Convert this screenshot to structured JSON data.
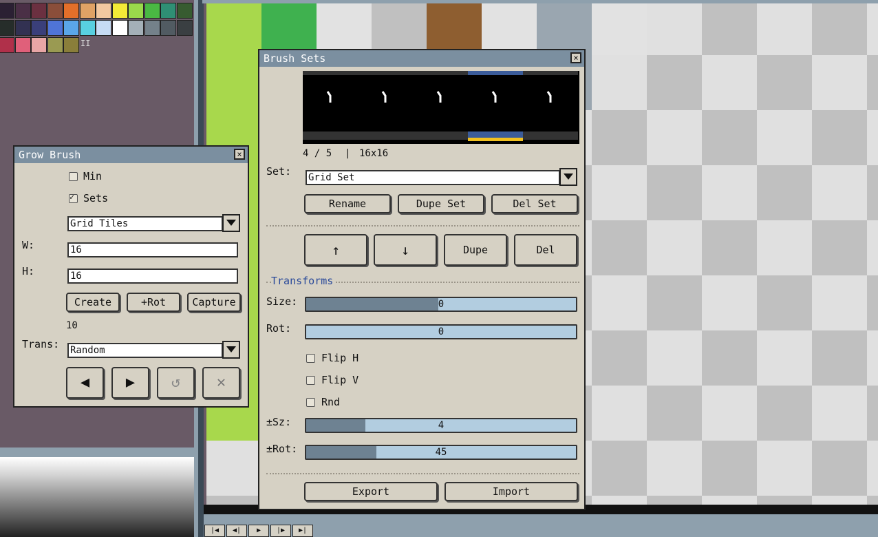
{
  "palette": {
    "colors": [
      "#2b2033",
      "#4a2f46",
      "#6b3040",
      "#8a4e3a",
      "#e36f2a",
      "#e0a265",
      "#f2c8a0",
      "#f4ea37",
      "#9ad94b",
      "#4ab843",
      "#2f8f74",
      "#375b30",
      "#262d2a",
      "#323152",
      "#3a3f7a",
      "#4f74d6",
      "#5aa6e8",
      "#58d0e0",
      "#c6dcf4",
      "#ffffff",
      "#a4b0b8",
      "#74818a",
      "#515b62",
      "#3a3f42",
      "#b0304a",
      "#e0607a",
      "#e8a6a6",
      "#9a9a52",
      "#8a7e3a"
    ],
    "extra_label": "II"
  },
  "grow_brush": {
    "title": "Grow Brush",
    "close": "×",
    "min_label": "Min",
    "sets_label": "Sets",
    "sets_checked": true,
    "set_select": "Grid Tiles",
    "w_label": "W:",
    "w_value": "16",
    "h_label": "H:",
    "h_value": "16",
    "create_label": "Create",
    "rot_label": "+Rot",
    "capture_label": "Capture",
    "count": "10",
    "trans_label": "Trans:",
    "trans_select": "Random",
    "prev_icon": "◀",
    "next_icon": "▶",
    "reset_icon": "↺",
    "clear_icon": "✕"
  },
  "brush_sets": {
    "title": "Brush Sets",
    "close": "×",
    "frame_info": "4 / 5",
    "frame_sep": "|",
    "size_info": "16x16",
    "set_label": "Set:",
    "set_select": "Grid Set",
    "rename_label": "Rename",
    "dupe_set_label": "Dupe Set",
    "del_set_label": "Del Set",
    "up_label": "↑",
    "down_label": "↓",
    "dupe_label": "Dupe",
    "del_label": "Del",
    "transforms_label": "Transforms",
    "size_label": "Size:",
    "size_value": "0",
    "rot_label": "Rot:",
    "rot_value": "0",
    "flip_h_label": "Flip H",
    "flip_v_label": "Flip V",
    "rnd_label": "Rnd",
    "psz_label": "±Sz:",
    "psz_value": "4",
    "psz_fraction": 0.22,
    "prot_label": "±Rot:",
    "prot_value": "45",
    "prot_fraction": 0.26,
    "export_label": "Export",
    "import_label": "Import"
  },
  "timeline": {
    "buttons": [
      "|◀",
      "◀|",
      "▶",
      "|▶",
      "▶|"
    ]
  },
  "colors": {
    "titlebar": "#7b8fa0",
    "window_bg": "#d6d1c4",
    "slider_bg": "#b2cde0",
    "slider_fill": "#6e8292",
    "selected_frame": "#3b5c9a"
  }
}
